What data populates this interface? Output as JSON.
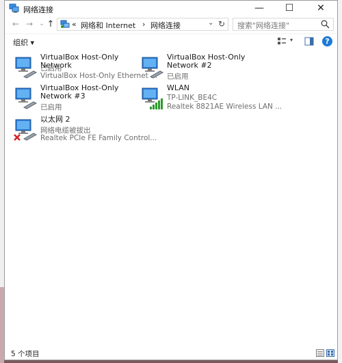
{
  "window": {
    "title": "网络连接",
    "icon": "network-connections-icon",
    "controls": {
      "minimize": "—",
      "maximize": "☐",
      "close": "✕"
    }
  },
  "nav": {
    "back": "←",
    "forward": "→",
    "recent": "⌄",
    "up": "↑"
  },
  "address": {
    "prefix": "«",
    "segments": [
      "网络和 Internet",
      "网络连接"
    ],
    "separator": "›",
    "dropdown": "⌄",
    "refresh": "↻"
  },
  "search": {
    "placeholder": "搜索\"网络连接\""
  },
  "toolbar": {
    "organize_label": "组织 ▾",
    "view_caret": "▾",
    "help": "?"
  },
  "items": [
    {
      "name": "VirtualBox Host-Only Network",
      "status": "已启用",
      "device": "VirtualBox Host-Only Ethernet ...",
      "type": "ethernet",
      "state": "enabled"
    },
    {
      "name": "VirtualBox Host-Only Network #2",
      "status": "已启用",
      "device": "",
      "type": "ethernet",
      "state": "enabled"
    },
    {
      "name": "VirtualBox Host-Only Network #3",
      "status": "已启用",
      "device": "",
      "type": "ethernet",
      "state": "enabled"
    },
    {
      "name": "WLAN",
      "status": "TP-LINK_BE4C",
      "device": "Realtek 8821AE Wireless LAN ...",
      "type": "wifi",
      "state": "connected"
    },
    {
      "name": "以太网 2",
      "status": "网络电缆被拔出",
      "device": "Realtek PCIe FE Family Control...",
      "type": "ethernet",
      "state": "unplugged"
    }
  ],
  "status_bar": {
    "count": "5 个项目"
  },
  "colors": {
    "accent": "#1c7bd6",
    "signal": "#2d9a2d",
    "error": "#d81e1e"
  }
}
